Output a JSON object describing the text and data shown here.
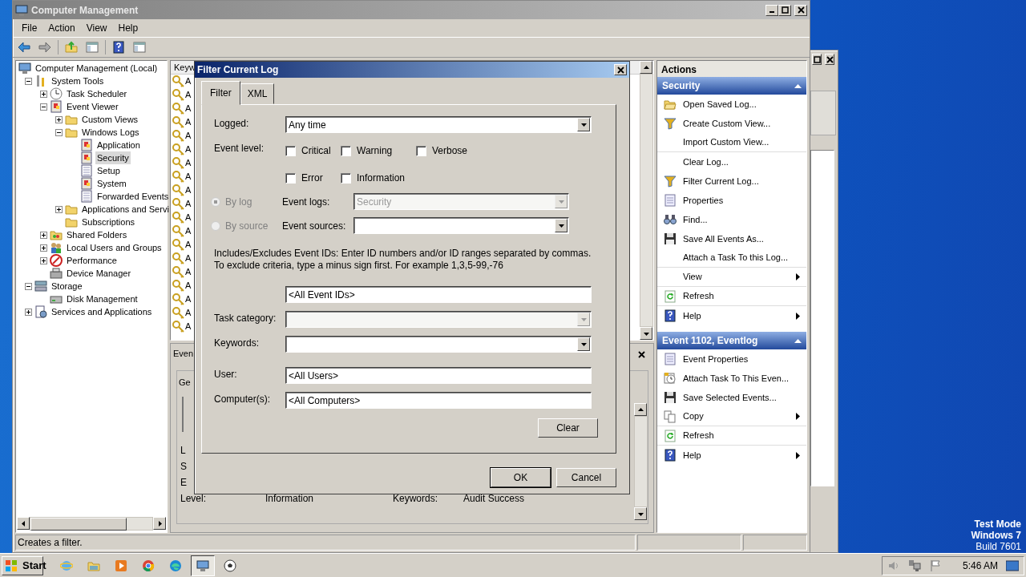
{
  "window": {
    "title": "Computer Management"
  },
  "menu": [
    "File",
    "Action",
    "View",
    "Help"
  ],
  "toolbar": [
    {
      "kind": "back"
    },
    {
      "kind": "fwd"
    },
    {
      "kind": "up"
    },
    {
      "kind": "pane"
    },
    {
      "kind": "help"
    },
    {
      "kind": "pane"
    }
  ],
  "tree": [
    {
      "label": "Computer Management (Local)",
      "kind": "computer",
      "selected": false,
      "children": [
        {
          "label": "System Tools",
          "kind": "tools",
          "expanded": true,
          "selected": false,
          "children": [
            {
              "label": "Task Scheduler",
              "kind": "clock",
              "expanded": false,
              "selected": false
            },
            {
              "label": "Event Viewer",
              "kind": "viewer",
              "expanded": true,
              "selected": false,
              "children": [
                {
                  "label": "Custom Views",
                  "kind": "folder",
                  "expanded": false,
                  "selected": false
                },
                {
                  "label": "Windows Logs",
                  "kind": "folder",
                  "expanded": true,
                  "selected": false,
                  "children": [
                    {
                      "label": "Application",
                      "kind": "viewer",
                      "selected": false
                    },
                    {
                      "label": "Security",
                      "kind": "viewer",
                      "selected": true
                    },
                    {
                      "label": "Setup",
                      "kind": "log",
                      "selected": false
                    },
                    {
                      "label": "System",
                      "kind": "viewer",
                      "selected": false
                    },
                    {
                      "label": "Forwarded Events",
                      "kind": "log",
                      "selected": false
                    }
                  ]
                },
                {
                  "label": "Applications and Servi",
                  "kind": "folder",
                  "expanded": false,
                  "selected": false
                },
                {
                  "label": "Subscriptions",
                  "kind": "folder",
                  "selected": false
                }
              ]
            },
            {
              "label": "Shared Folders",
              "kind": "share",
              "expanded": false,
              "selected": false
            },
            {
              "label": "Local Users and Groups",
              "kind": "users",
              "expanded": false,
              "selected": false
            },
            {
              "label": "Performance",
              "kind": "perf",
              "expanded": false,
              "selected": false
            },
            {
              "label": "Device Manager",
              "kind": "device",
              "selected": false
            }
          ]
        },
        {
          "label": "Storage",
          "kind": "storage",
          "expanded": true,
          "selected": false,
          "children": [
            {
              "label": "Disk Management",
              "kind": "disk",
              "selected": false
            }
          ]
        },
        {
          "label": "Services and Applications",
          "kind": "services",
          "expanded": false,
          "selected": false
        }
      ]
    }
  ],
  "event_list": {
    "columns": [
      "Keyw"
    ],
    "rows": [
      "A",
      "A",
      "A",
      "A",
      "A",
      "A",
      "A",
      "A",
      "A",
      "A",
      "A",
      "A",
      "A",
      "A",
      "A",
      "A",
      "A",
      "A",
      "A"
    ]
  },
  "event_details": {
    "title": "Even",
    "tab": "Ge",
    "labels": [
      "L",
      "S",
      "E"
    ],
    "level_row": [
      "Level:",
      "Information",
      "Keywords:",
      "Audit Success"
    ]
  },
  "actions": {
    "title": "Actions",
    "sections": [
      {
        "title": "Security",
        "items": [
          {
            "label": "Open Saved Log...",
            "kind": "open",
            "submenu": false,
            "divider": false
          },
          {
            "label": "Create Custom View...",
            "kind": "filter",
            "submenu": false,
            "divider": false
          },
          {
            "label": "Import Custom View...",
            "submenu": false,
            "divider": true
          },
          {
            "label": "Clear Log...",
            "submenu": false,
            "divider": false
          },
          {
            "label": "Filter Current Log...",
            "kind": "filter",
            "submenu": false,
            "divider": false
          },
          {
            "label": "Properties",
            "kind": "props",
            "submenu": false,
            "divider": false
          },
          {
            "label": "Find...",
            "kind": "find",
            "submenu": false,
            "divider": false
          },
          {
            "label": "Save All Events As...",
            "kind": "save",
            "submenu": false,
            "divider": false
          },
          {
            "label": "Attach a Task To this Log...",
            "submenu": false,
            "divider": true
          },
          {
            "label": "View",
            "submenu": true,
            "divider": true
          },
          {
            "label": "Refresh",
            "kind": "refresh",
            "submenu": false,
            "divider": true
          },
          {
            "label": "Help",
            "kind": "help",
            "submenu": true,
            "divider": false
          }
        ]
      },
      {
        "title": "Event 1102, Eventlog",
        "items": [
          {
            "label": "Event Properties",
            "kind": "props",
            "submenu": false,
            "divider": false
          },
          {
            "label": "Attach Task To This Even...",
            "kind": "task",
            "submenu": false,
            "divider": false
          },
          {
            "label": "Save Selected Events...",
            "kind": "save",
            "submenu": false,
            "divider": false
          },
          {
            "label": "Copy",
            "kind": "copy",
            "submenu": true,
            "divider": true
          },
          {
            "label": "Refresh",
            "kind": "refresh",
            "submenu": false,
            "divider": true
          },
          {
            "label": "Help",
            "kind": "help",
            "submenu": true,
            "divider": false
          }
        ]
      }
    ]
  },
  "status_bar": {
    "text": "Creates a filter."
  },
  "dialog": {
    "title": "Filter Current Log",
    "tabs": [
      {
        "label": "Filter",
        "selected": true
      },
      {
        "label": "XML",
        "selected": false
      }
    ],
    "logged": {
      "label": "Logged:",
      "value": "Any time"
    },
    "event_level": {
      "label": "Event level:",
      "options": [
        {
          "label": "Critical",
          "checked": false
        },
        {
          "label": "Warning",
          "checked": false
        },
        {
          "label": "Verbose",
          "checked": false
        },
        {
          "label": "Error",
          "checked": false
        },
        {
          "label": "Information",
          "checked": false
        }
      ]
    },
    "sources": [
      {
        "radio": "By log",
        "selected": true,
        "radio_disabled": true,
        "label": "Event logs:",
        "value": "Security",
        "disabled": true
      },
      {
        "radio": "By source",
        "selected": false,
        "radio_disabled": true,
        "label": "Event sources:",
        "disabled": false
      }
    ],
    "ids_hint": "Includes/Excludes Event IDs: Enter ID numbers and/or ID ranges separated by commas. To exclude criteria, type a minus sign first. For example 1,3,5-99,-76",
    "event_ids": "<All Event IDs>",
    "fields": [
      {
        "kind": "select",
        "label": "Task category:",
        "disabled": true
      },
      {
        "kind": "select",
        "label": "Keywords:",
        "disabled": false
      },
      {
        "kind": "text",
        "label": "User:",
        "value": "<All Users>"
      },
      {
        "kind": "text",
        "label": "Computer(s):",
        "value": "<All Computers>"
      }
    ],
    "clear": "Clear",
    "buttons": [
      {
        "label": "OK",
        "default": true
      },
      {
        "label": "Cancel",
        "default": false
      }
    ]
  },
  "taskbar": {
    "start": "Start",
    "apps": [
      {
        "kind": "ie",
        "active": false
      },
      {
        "kind": "explorer",
        "active": false
      },
      {
        "kind": "media",
        "active": false
      },
      {
        "kind": "chrome",
        "active": false
      },
      {
        "kind": "edge",
        "active": false
      },
      {
        "kind": "computer",
        "active": true
      },
      {
        "kind": "ball",
        "active": false
      }
    ],
    "clock": "5:46 AM"
  },
  "desktop_notice": [
    {
      "text": "Test Mode",
      "bold": true
    },
    {
      "text": "Windows 7",
      "bold": true
    },
    {
      "text": "Build 7601",
      "bold": false
    }
  ]
}
